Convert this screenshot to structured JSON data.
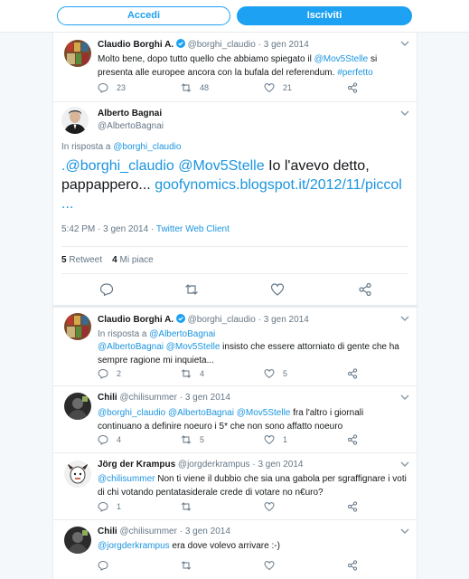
{
  "topbar": {
    "login_label": "Accedi",
    "signup_label": "Iscriviti"
  },
  "tweets": [
    {
      "name": "Claudio Borghi A.",
      "handle": "@borghi_claudio",
      "date": "3 gen 2014",
      "text_parts": [
        "Molto bene, dopo tutto quello che abbiamo spiegato il ",
        "@Mov5Stelle",
        " si presenta alle europee ancora con la bufala del referendum. ",
        "#perfetto"
      ],
      "replies": "23",
      "retweets": "48",
      "likes": "21"
    },
    {
      "name": "Alberto Bagnai",
      "handle": "@AlbertoBagnai",
      "reply_prefix": "In risposta a ",
      "reply_to": "@borghi_claudio",
      "text_parts": [
        ".",
        "@borghi_claudio",
        " ",
        "@Mov5Stelle",
        " Io l'avevo detto, pappappero... ",
        "goofynomics.blogspot.it/2012/11/piccol",
        "..."
      ],
      "timestamp": "5:42 PM · 3 gen 2014 · ",
      "client": "Twitter Web Client",
      "retweets_count": "5",
      "retweets_label": " Retweet",
      "likes_count": "4",
      "likes_label": " Mi piace"
    },
    {
      "name": "Claudio Borghi A.",
      "handle": "@borghi_claudio",
      "date": "3 gen 2014",
      "reply_prefix": "In risposta a ",
      "reply_to": "@AlbertoBagnai",
      "text_parts": [
        "@AlbertoBagnai",
        " ",
        "@Mov5Stelle",
        " insisto che essere attorniato di gente che ha sempre ragione mi inquieta..."
      ],
      "replies": "2",
      "retweets": "4",
      "likes": "5"
    },
    {
      "name": "Chili",
      "handle": "@chilisummer",
      "date": "3 gen 2014",
      "text_parts": [
        "@borghi_claudio",
        " ",
        "@AlbertoBagnai",
        " ",
        "@Mov5Stelle",
        " fra l'altro i giornali continuano a definire noeuro i 5* che non sono affatto noeuro"
      ],
      "replies": "4",
      "retweets": "5",
      "likes": "1"
    },
    {
      "name": "Jörg der Krampus",
      "handle": "@jorgderkrampus",
      "date": "3 gen 2014",
      "text_parts": [
        "@chilisummer",
        " Non ti viene il dubbio che sia una gabola per sgraffignare i voti di chi votando pentatasiderale crede di votare no n€uro?"
      ],
      "replies": "1",
      "retweets": "",
      "likes": ""
    },
    {
      "name": "Chili",
      "handle": "@chilisummer",
      "date": "3 gen 2014",
      "text_parts": [
        "@jorgderkrampus",
        " era dove volevo arrivare :-)"
      ],
      "replies": "",
      "retweets": "",
      "likes": ""
    }
  ],
  "icons": {
    "reply": "reply-icon",
    "retweet": "retweet-icon",
    "like": "heart-icon",
    "share": "share-icon",
    "verified": "verified-badge-icon",
    "caret": "chevron-down-icon"
  },
  "colors": {
    "accent": "#1da1f2",
    "link": "#1b95e0",
    "muted": "#657786",
    "text": "#14171a",
    "border": "#e6ecf0"
  }
}
